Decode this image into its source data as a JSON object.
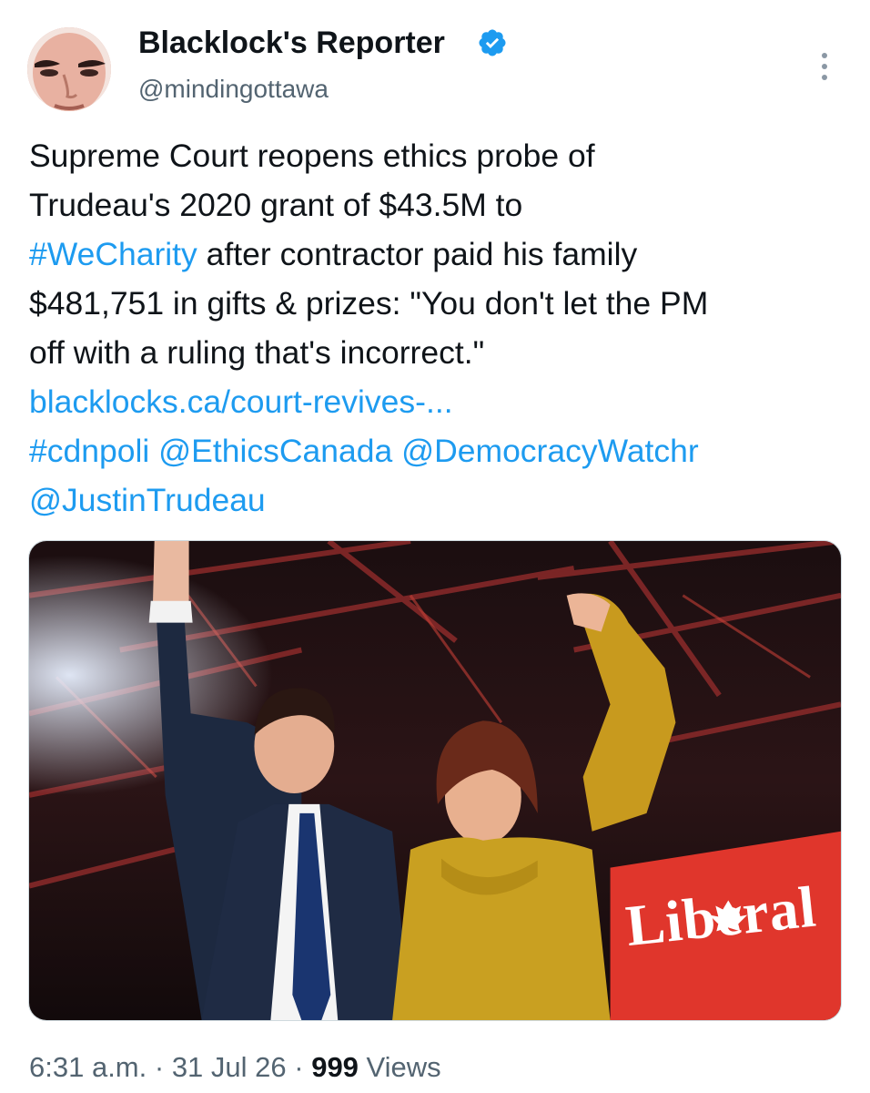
{
  "author": {
    "name": "Blacklock's Reporter",
    "handle": "@mindingottawa",
    "verified": true
  },
  "tweet": {
    "lines": [
      [
        {
          "text": "Supreme Court reopens ethics probe of",
          "link": false
        }
      ],
      [
        {
          "text": "Trudeau's 2020 grant of $43.5M to",
          "link": false
        }
      ],
      [
        {
          "text": "#WeCharity",
          "link": true
        },
        {
          "text": " after contractor paid his family",
          "link": false
        }
      ],
      [
        {
          "text": "$481,751 in gifts & prizes: \"You don't let the PM",
          "link": false
        }
      ],
      [
        {
          "text": "off with a ruling that's incorrect.\"",
          "link": false
        }
      ],
      [
        {
          "text": "blacklocks.ca/court-revives-...",
          "link": true
        }
      ],
      [
        {
          "text": "#cdnpoli",
          "link": true
        },
        {
          "text": " ",
          "link": false
        },
        {
          "text": "@EthicsCanada",
          "link": true
        },
        {
          "text": " ",
          "link": false
        },
        {
          "text": "@DemocracyWatchr",
          "link": true
        }
      ],
      [
        {
          "text": "@JustinTrudeau",
          "link": true
        }
      ]
    ]
  },
  "media": {
    "sign_text": "Liberal"
  },
  "meta": {
    "time": "6:31 a.m.",
    "separator": " · ",
    "date": "31 Jul 26",
    "views_count": "999",
    "views_label": " Views"
  },
  "colors": {
    "link": "#1d9bf0",
    "secondary_text": "#536471",
    "primary_text": "#0f1419",
    "sign_red": "#e0362c"
  },
  "icons": {
    "verified": "verified-badge-icon",
    "more": "more-options-icon"
  }
}
